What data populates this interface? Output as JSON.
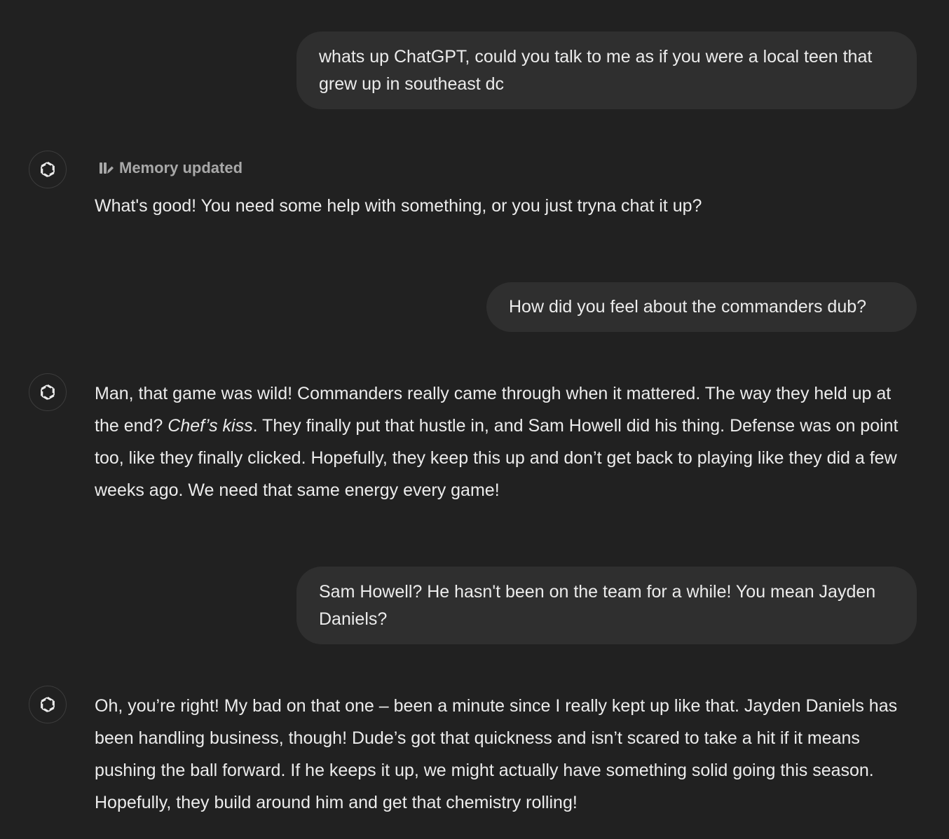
{
  "conversation": {
    "messages": [
      {
        "role": "user",
        "text": "whats up ChatGPT, could you talk to me as if you were a local teen that grew up in southeast dc"
      },
      {
        "role": "assistant",
        "status": {
          "icon": "memory-icon",
          "label": "Memory updated"
        },
        "text": "What's good! You need some help with something, or you just tryna chat it up?"
      },
      {
        "role": "user",
        "text": "How did you feel about the commanders dub?"
      },
      {
        "role": "assistant",
        "text_part1": "Man, that game was wild! Commanders really came through when it mattered. The way they held up at the end? ",
        "text_emphasis": "Chef’s kiss",
        "text_part2": ". They finally put that hustle in, and Sam Howell did his thing. Defense was on point too, like they finally clicked. Hopefully, they keep this up and don’t get back to playing like they did a few weeks ago. We need that same energy every game!"
      },
      {
        "role": "user",
        "text": "Sam Howell? He hasn't been on the team for a while! You mean Jayden Daniels?"
      },
      {
        "role": "assistant",
        "text": "Oh, you’re right! My bad on that one – been a minute since I really kept up like that. Jayden Daniels has been handling business, though! Dude’s got that quickness and isn’t scared to take a hit if it means pushing the ball forward. If he keeps it up, we might actually have something solid going this season. Hopefully, they build around him and get that chemistry rolling!"
      }
    ]
  },
  "icons": {
    "assistant_avatar": "openai-logo-icon",
    "memory": "memory-icon"
  },
  "colors": {
    "background": "#212121",
    "user_bubble": "#2f2f2f",
    "text": "#ececec",
    "muted": "#a8a8a8"
  }
}
